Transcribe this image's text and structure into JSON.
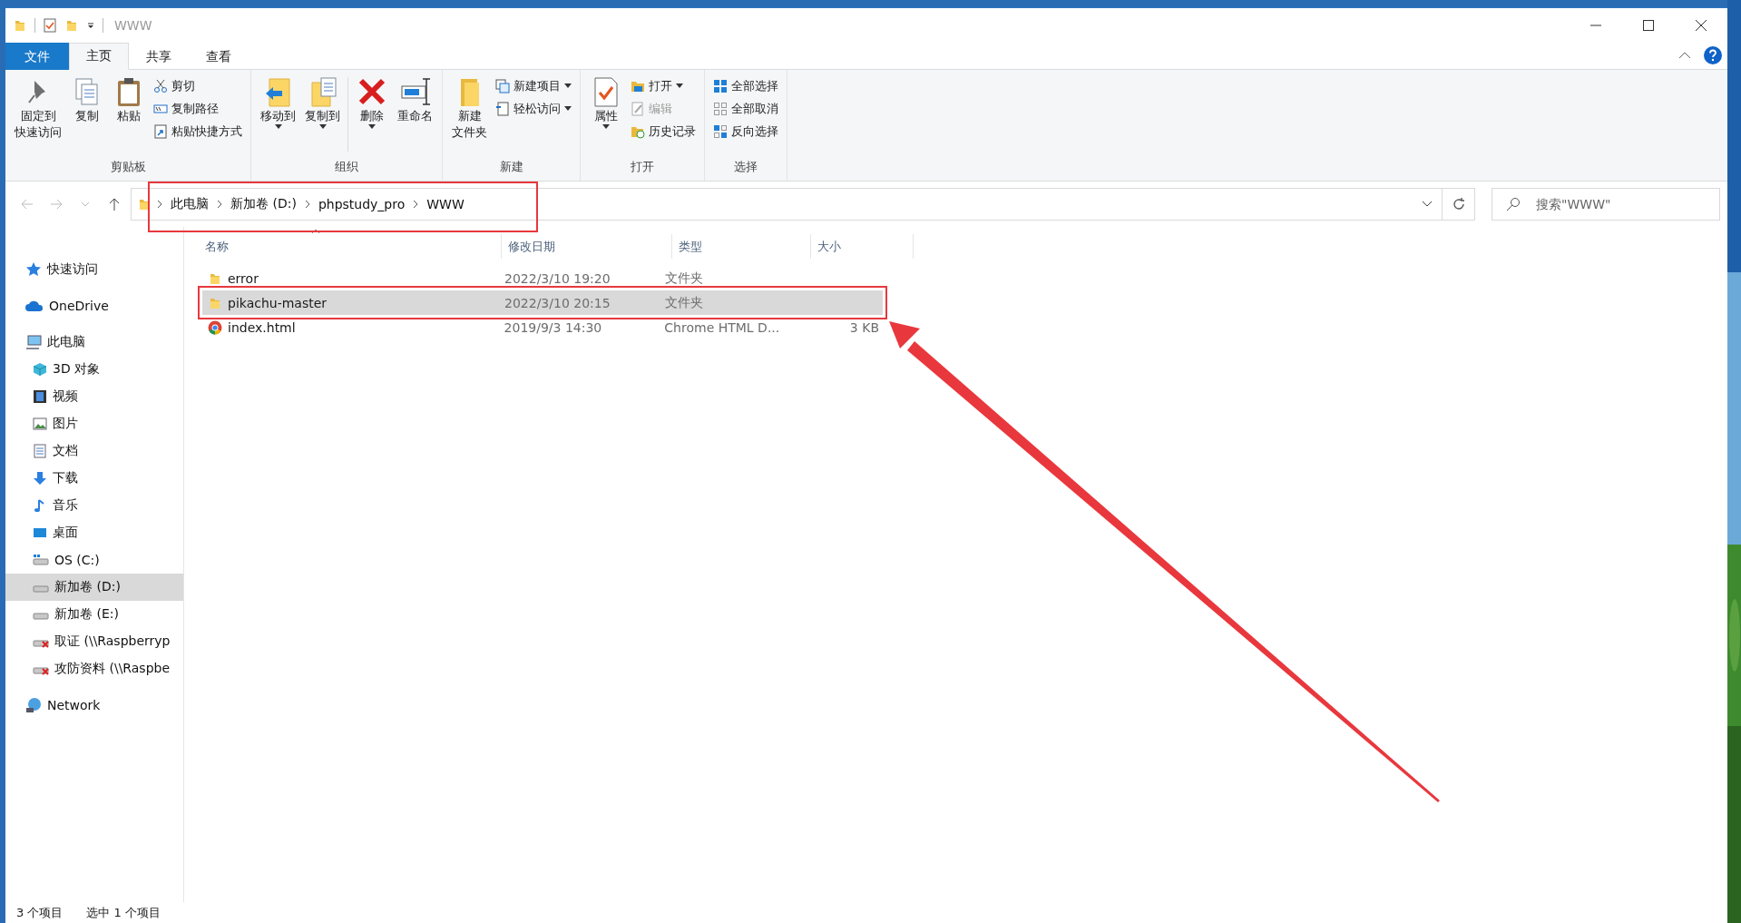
{
  "window": {
    "title": "WWW"
  },
  "tabs": [
    {
      "label": "文件",
      "kind": "file",
      "selected": false
    },
    {
      "label": "主页",
      "kind": "tab",
      "selected": true
    },
    {
      "label": "共享",
      "kind": "tab",
      "selected": false
    },
    {
      "label": "查看",
      "kind": "tab",
      "selected": false
    }
  ],
  "ribbon": [
    {
      "label": "剪贴板",
      "items": [
        {
          "kind": "large",
          "lines": [
            "固定到",
            "快速访问"
          ],
          "dropdown": false
        },
        {
          "kind": "large",
          "label": "复制",
          "dropdown": false
        },
        {
          "kind": "large",
          "label": "粘贴",
          "dropdown": false
        },
        {
          "kind": "stack",
          "items": [
            {
              "label": "剪切",
              "dropdown": false,
              "disabled": false
            },
            {
              "label": "复制路径",
              "dropdown": false,
              "disabled": false
            },
            {
              "label": "粘贴快捷方式",
              "dropdown": false,
              "disabled": false
            }
          ]
        }
      ]
    },
    {
      "label": "组织",
      "items": [
        {
          "kind": "large",
          "label": "移动到",
          "dropdown": true
        },
        {
          "kind": "large",
          "label": "复制到",
          "dropdown": true
        },
        {
          "kind": "separator"
        },
        {
          "kind": "large",
          "label": "删除",
          "dropdown": true
        },
        {
          "kind": "large",
          "label": "重命名",
          "dropdown": false
        }
      ]
    },
    {
      "label": "新建",
      "items": [
        {
          "kind": "large",
          "lines": [
            "新建",
            "文件夹"
          ],
          "dropdown": false
        },
        {
          "kind": "stack",
          "items": [
            {
              "label": "新建项目",
              "dropdown": true,
              "disabled": false
            },
            {
              "label": "轻松访问",
              "dropdown": true,
              "disabled": false
            }
          ]
        }
      ]
    },
    {
      "label": "打开",
      "items": [
        {
          "kind": "large",
          "label": "属性",
          "dropdown": true
        },
        {
          "kind": "stack",
          "items": [
            {
              "label": "打开",
              "dropdown": true,
              "disabled": false
            },
            {
              "label": "编辑",
              "dropdown": false,
              "disabled": true
            },
            {
              "label": "历史记录",
              "dropdown": false,
              "disabled": false
            }
          ]
        }
      ]
    },
    {
      "label": "选择",
      "items": [
        {
          "kind": "stack",
          "items": [
            {
              "label": "全部选择",
              "dropdown": false,
              "disabled": false
            },
            {
              "label": "全部取消",
              "dropdown": false,
              "disabled": false
            },
            {
              "label": "反向选择",
              "dropdown": false,
              "disabled": false
            }
          ]
        }
      ]
    }
  ],
  "address": {
    "breadcrumb": [
      "此电脑",
      "新加卷 (D:)",
      "phpstudy_pro",
      "WWW"
    ]
  },
  "search": {
    "placeholder": "搜索\"WWW\""
  },
  "navigation": [
    {
      "label": "快速访问",
      "selected": false
    },
    {
      "label": "OneDrive",
      "selected": false
    },
    {
      "label": "此电脑",
      "selected": false,
      "children": [
        {
          "label": "3D 对象",
          "selected": false
        },
        {
          "label": "视频",
          "selected": false
        },
        {
          "label": "图片",
          "selected": false
        },
        {
          "label": "文档",
          "selected": false
        },
        {
          "label": "下载",
          "selected": false
        },
        {
          "label": "音乐",
          "selected": false
        },
        {
          "label": "桌面",
          "selected": false
        },
        {
          "label": "OS (C:)",
          "selected": false
        },
        {
          "label": "新加卷 (D:)",
          "selected": true
        },
        {
          "label": "新加卷 (E:)",
          "selected": false
        },
        {
          "label": "取证 (\\\\Raspberryp",
          "selected": false
        },
        {
          "label": "攻防资料 (\\\\Raspbe",
          "selected": false
        }
      ]
    },
    {
      "label": "Network",
      "selected": false
    }
  ],
  "files": {
    "columns": [
      "名称",
      "修改日期",
      "类型",
      "大小"
    ],
    "rows": [
      {
        "kind": "folder",
        "name": "error",
        "modified": "2022/3/10 19:20",
        "type": "文件夹",
        "size": null,
        "selected": false
      },
      {
        "kind": "folder",
        "name": "pikachu-master",
        "modified": "2022/3/10 20:15",
        "type": "文件夹",
        "size": null,
        "selected": true
      },
      {
        "kind": "html",
        "name": "index.html",
        "modified": "2019/9/3 14:30",
        "type": "Chrome HTML D...",
        "size": "3 KB",
        "selected": false
      }
    ]
  },
  "status_bar": [
    "3 个项目",
    "选中 1 个项目"
  ]
}
